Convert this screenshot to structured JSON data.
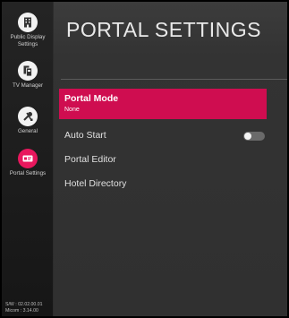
{
  "sidebar": {
    "items": [
      {
        "label_line1": "Public Display",
        "label_line2": "Settings",
        "icon": "building-icon",
        "active": false
      },
      {
        "label": "TV Manager",
        "icon": "tv-manager-icon",
        "active": false
      },
      {
        "label": "General",
        "icon": "tools-icon",
        "active": false
      },
      {
        "label": "Portal Settings",
        "icon": "portal-icon",
        "active": true
      }
    ],
    "version_sw": "S/W : 02.02.00.01",
    "version_micom": "Micom : 3.14.00"
  },
  "main": {
    "title": "PORTAL SETTINGS",
    "menu": {
      "portal_mode": {
        "label": "Portal Mode",
        "value": "None"
      },
      "auto_start": {
        "label": "Auto Start",
        "toggle": "off"
      },
      "portal_editor": {
        "label": "Portal Editor"
      },
      "hotel_directory": {
        "label": "Hotel Directory"
      }
    }
  },
  "colors": {
    "accent": "#cf0d50",
    "active_icon": "#e8175d",
    "background": "#303030",
    "sidebar": "#1e1e1e"
  }
}
